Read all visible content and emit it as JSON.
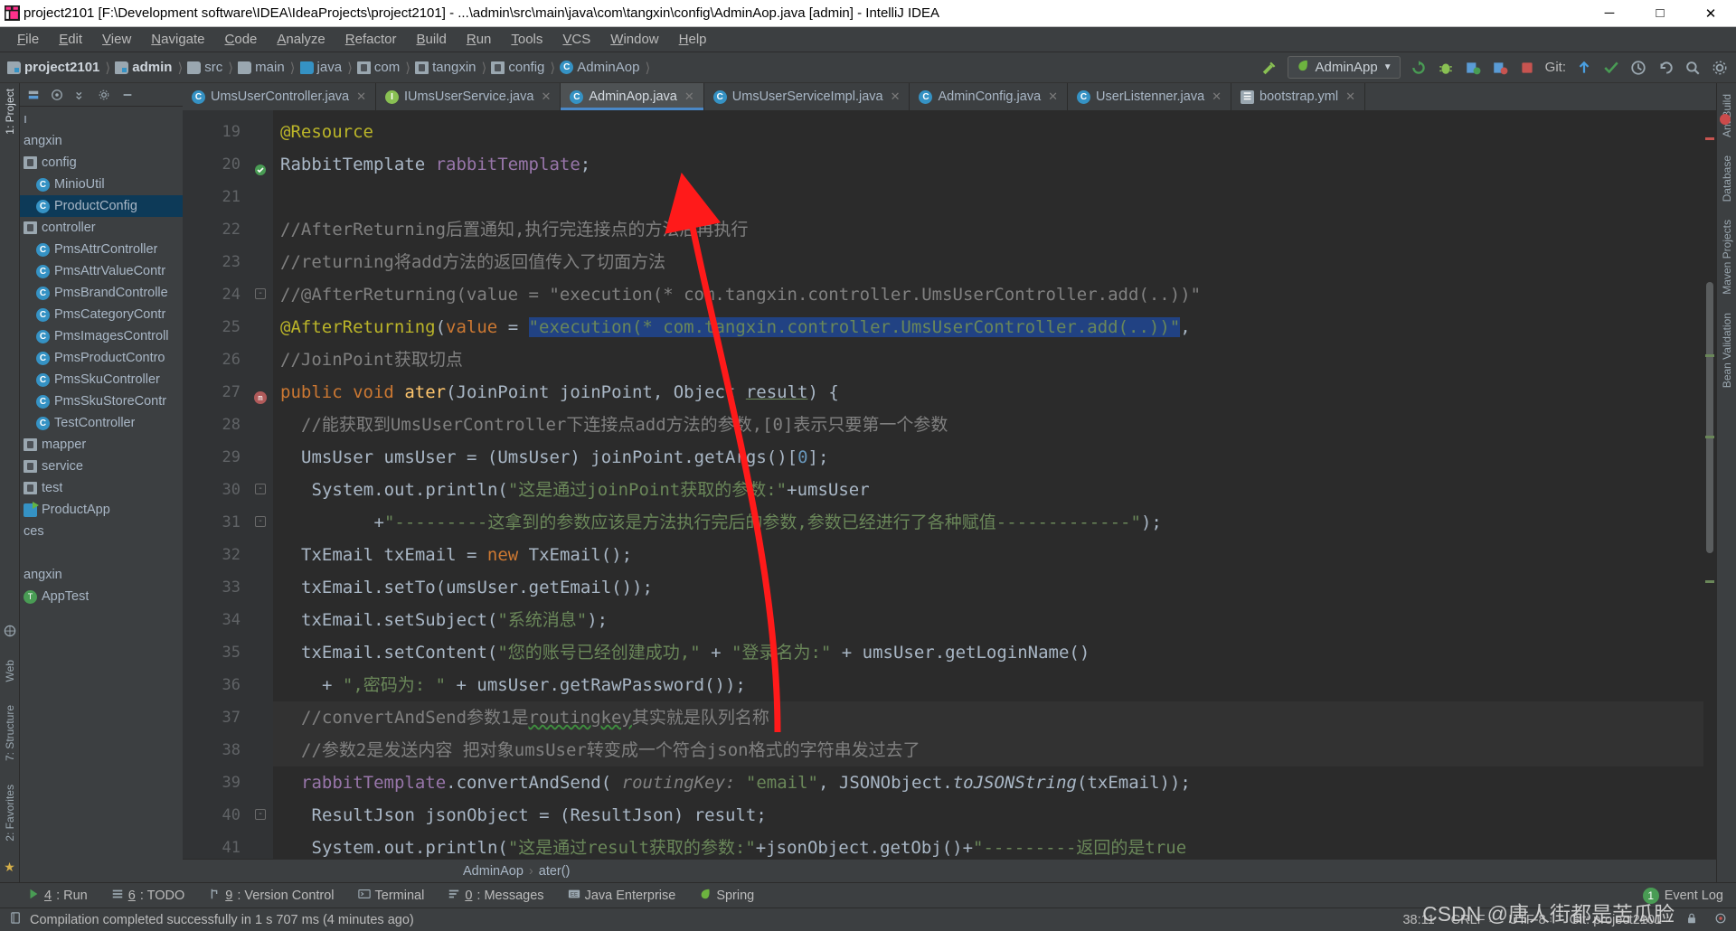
{
  "window": {
    "title": "project2101 [F:\\Development software\\IDEA\\IdeaProjects\\project2101] - ...\\admin\\src\\main\\java\\com\\tangxin\\config\\AdminAop.java [admin] - IntelliJ IDEA",
    "app_icon": "intellij-idea-icon",
    "minimize": "─",
    "maximize": "□",
    "close": "✕"
  },
  "menubar": {
    "items": [
      "File",
      "Edit",
      "View",
      "Navigate",
      "Code",
      "Analyze",
      "Refactor",
      "Build",
      "Run",
      "Tools",
      "VCS",
      "Window",
      "Help"
    ]
  },
  "navbar": {
    "breadcrumbs": [
      {
        "label": "project2101",
        "icon": "module-icon",
        "bold": true
      },
      {
        "label": "admin",
        "icon": "module-icon",
        "bold": true
      },
      {
        "label": "src",
        "icon": "folder-icon"
      },
      {
        "label": "main",
        "icon": "folder-icon"
      },
      {
        "label": "java",
        "icon": "folder-blue-icon"
      },
      {
        "label": "com",
        "icon": "package-icon"
      },
      {
        "label": "tangxin",
        "icon": "package-icon"
      },
      {
        "label": "config",
        "icon": "package-icon"
      },
      {
        "label": "AdminAop",
        "icon": "class-icon"
      }
    ],
    "run_config": "AdminApp",
    "run_config_icon": "spring-leaf-icon",
    "git_label": "Git:",
    "icons": [
      "build-hammer-icon",
      "run-icon",
      "debug-icon",
      "coverage-icon",
      "profiler-icon",
      "stop-icon",
      "update-project-icon",
      "commit-icon",
      "checkmark-icon",
      "history-icon",
      "undo-icon",
      "search-everywhere-icon",
      "settings-icon"
    ]
  },
  "project_pane": {
    "toolbar_icons": [
      "flatten-packages-icon",
      "expand-icon",
      "collapse-all-icon",
      "settings-gear-icon",
      "hide-icon"
    ],
    "label": "1: Project",
    "tree": [
      {
        "label": "ı",
        "icon": "none",
        "indent": 0,
        "selected": false
      },
      {
        "label": "angxin",
        "icon": "none",
        "indent": 0,
        "selected": false
      },
      {
        "label": "config",
        "icon": "package-icon",
        "indent": 0,
        "selected": false
      },
      {
        "label": "MinioUtil",
        "icon": "class-icon",
        "indent": 1,
        "selected": false
      },
      {
        "label": "ProductConfig",
        "icon": "class-icon",
        "indent": 1,
        "selected": true
      },
      {
        "label": "controller",
        "icon": "package-icon",
        "indent": 0,
        "selected": false
      },
      {
        "label": "PmsAttrController",
        "icon": "class-icon",
        "indent": 1,
        "selected": false
      },
      {
        "label": "PmsAttrValueContr",
        "icon": "class-icon",
        "indent": 1,
        "selected": false
      },
      {
        "label": "PmsBrandControlle",
        "icon": "class-icon",
        "indent": 1,
        "selected": false
      },
      {
        "label": "PmsCategoryContr",
        "icon": "class-icon",
        "indent": 1,
        "selected": false
      },
      {
        "label": "PmsImagesControll",
        "icon": "class-icon",
        "indent": 1,
        "selected": false
      },
      {
        "label": "PmsProductContro",
        "icon": "class-icon",
        "indent": 1,
        "selected": false
      },
      {
        "label": "PmsSkuController",
        "icon": "class-icon",
        "indent": 1,
        "selected": false
      },
      {
        "label": "PmsSkuStoreContr",
        "icon": "class-icon",
        "indent": 1,
        "selected": false
      },
      {
        "label": "TestController",
        "icon": "class-icon",
        "indent": 1,
        "selected": false
      },
      {
        "label": "mapper",
        "icon": "package-icon",
        "indent": 0,
        "selected": false
      },
      {
        "label": "service",
        "icon": "package-icon",
        "indent": 0,
        "selected": false
      },
      {
        "label": "test",
        "icon": "package-icon",
        "indent": 0,
        "selected": false
      },
      {
        "label": "ProductApp",
        "icon": "spring-app-icon",
        "indent": 0,
        "selected": false
      },
      {
        "label": "ces",
        "icon": "none",
        "indent": 0,
        "selected": false
      },
      {
        "label": "",
        "icon": "none",
        "indent": 0,
        "selected": false
      },
      {
        "label": "angxin",
        "icon": "none",
        "indent": 0,
        "selected": false
      },
      {
        "label": "AppTest",
        "icon": "test-class-icon",
        "indent": 0,
        "selected": false
      }
    ]
  },
  "left_strip": {
    "top": "1: Project",
    "bottom": [
      "7: Structure",
      "2: Favorites"
    ],
    "web": "Web"
  },
  "right_strip": {
    "items": [
      "Ant Build",
      "Database",
      "Maven Projects",
      "Bean Validation"
    ]
  },
  "tabs": [
    {
      "label": "UmsUserController.java",
      "icon": "class-icon",
      "active": false
    },
    {
      "label": "IUmsUserService.java",
      "icon": "interface-icon",
      "active": false
    },
    {
      "label": "AdminAop.java",
      "icon": "class-icon",
      "active": true
    },
    {
      "label": "UmsUserServiceImpl.java",
      "icon": "class-icon",
      "active": false
    },
    {
      "label": "AdminConfig.java",
      "icon": "class-icon",
      "active": false
    },
    {
      "label": "UserListenner.java",
      "icon": "class-icon",
      "active": false
    },
    {
      "label": "bootstrap.yml",
      "icon": "yaml-icon",
      "active": false
    }
  ],
  "editor": {
    "first_line": 19,
    "lines": [
      {
        "n": 19,
        "text": "@Resource"
      },
      {
        "n": 20,
        "text": "RabbitTemplate rabbitTemplate;"
      },
      {
        "n": 21,
        "text": ""
      },
      {
        "n": 22,
        "text": "//AfterReturning后置通知,执行完连接点的方法后再执行"
      },
      {
        "n": 23,
        "text": "//returning将add方法的返回值传入了切面方法"
      },
      {
        "n": 24,
        "text": "//@AfterReturning(value = \"execution(* com.tangxin.controller.UmsUserController.add(..))\""
      },
      {
        "n": 25,
        "text": "@AfterReturning(value = \"execution(* com.tangxin.controller.UmsUserController.add(..))\","
      },
      {
        "n": 26,
        "text": "//JoinPoint获取切点"
      },
      {
        "n": 27,
        "text": "public void ater(JoinPoint joinPoint, Object result) {"
      },
      {
        "n": 28,
        "text": "//能获取到UmsUserController下连接点add方法的参数,[0]表示只要第一个参数"
      },
      {
        "n": 29,
        "text": "UmsUser umsUser = (UmsUser) joinPoint.getArgs()[0];"
      },
      {
        "n": 30,
        "text": "System.out.println(\"这是通过joinPoint获取的参数:\"+umsUser"
      },
      {
        "n": 31,
        "text": "+\"---------这拿到的参数应该是方法执行完后的参数,参数已经进行了各种赋值-------------\");"
      },
      {
        "n": 32,
        "text": "TxEmail txEmail = new TxEmail();"
      },
      {
        "n": 33,
        "text": "txEmail.setTo(umsUser.getEmail());"
      },
      {
        "n": 34,
        "text": "txEmail.setSubject(\"系统消息\");"
      },
      {
        "n": 35,
        "text": "txEmail.setContent(\"您的账号已经创建成功,\" + \"登录名为:\" + umsUser.getLoginName()"
      },
      {
        "n": 36,
        "text": "+ \",密码为: \" + umsUser.getRawPassword());"
      },
      {
        "n": 37,
        "text": "//convertAndSend参数1是routingkey其实就是队列名称"
      },
      {
        "n": 38,
        "text": "//参数2是发送内容 把对象umsUser转变成一个符合json格式的字符串发过去了"
      },
      {
        "n": 39,
        "text": "rabbitTemplate.convertAndSend( routingKey: \"email\", JSONObject.toJSONString(txEmail));"
      },
      {
        "n": 40,
        "text": "ResultJson jsonObject = (ResultJson) result;"
      },
      {
        "n": 41,
        "text": "System.out.println(\"这是通过result获取的参数:\"+jsonObject.getObj()+\"---------返回的是true"
      }
    ]
  },
  "editor_breadcrumbs": [
    {
      "label": "AdminAop"
    },
    {
      "label": "ater()"
    }
  ],
  "bottom_toolwindows": [
    {
      "num": "4",
      "label": ": Run",
      "icon": "run-icon"
    },
    {
      "num": "6",
      "label": ": TODO",
      "icon": "todo-icon"
    },
    {
      "num": "9",
      "label": ": Version Control",
      "icon": "vcs-icon"
    },
    {
      "num": "",
      "label": "Terminal",
      "icon": "terminal-icon"
    },
    {
      "num": "0",
      "label": ": Messages",
      "icon": "messages-icon"
    },
    {
      "num": "",
      "label": "Java Enterprise",
      "icon": "java-ee-icon"
    },
    {
      "num": "",
      "label": "Spring",
      "icon": "spring-leaf-icon"
    }
  ],
  "event_log": {
    "count": "1",
    "label": "Event Log"
  },
  "statusbar": {
    "message": "Compilation completed successfully in 1 s 707 ms (4 minutes ago)",
    "message_icon": "document-icon",
    "caret": "38:11",
    "line_sep": "CRLF",
    "encoding": "UTF-8",
    "git_branch": "Git: project2101",
    "lock_icon": "lock-icon",
    "inspection_icon": "inspections-icon"
  },
  "watermark": "CSDN @唐人街都是苦瓜脸",
  "colors": {
    "accent": "#4a88c7",
    "editor_bg": "#2b2b2b",
    "panel_bg": "#3c3f41",
    "gutter_bg": "#313335",
    "selection": "#214283",
    "arrow": "#ff1a1a",
    "string": "#6a8759",
    "keyword": "#cc7832",
    "comment": "#808080",
    "annotation": "#bbb529",
    "number": "#6897bb",
    "method": "#ffc66d"
  }
}
